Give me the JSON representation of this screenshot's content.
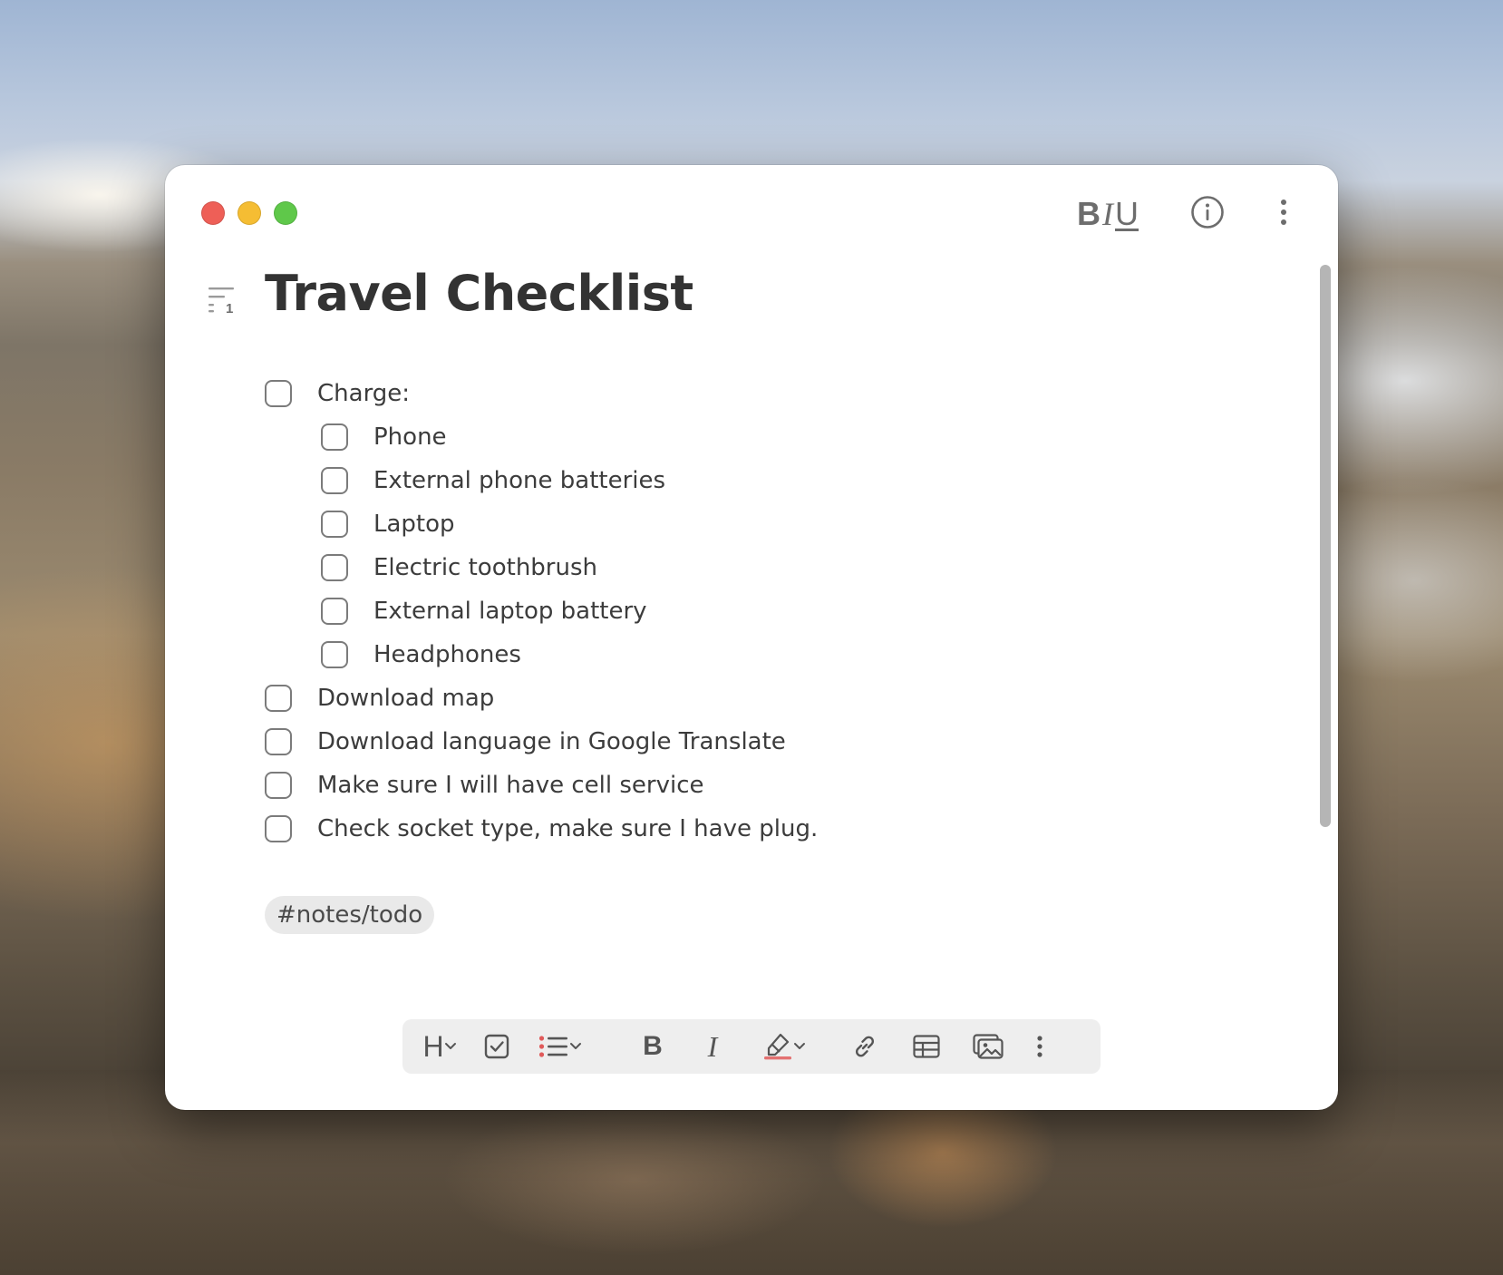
{
  "window": {
    "traffic_lights": [
      "close",
      "minimize",
      "zoom"
    ],
    "header": {
      "format_bold": "B",
      "format_italic": "I",
      "format_underline": "U",
      "info_icon": "info-circle-icon",
      "more_icon": "vertical-ellipsis-icon"
    }
  },
  "note": {
    "outline_number": "1",
    "title": "Travel Checklist",
    "todos": [
      {
        "label": "Charge:",
        "checked": false,
        "indent": 0
      },
      {
        "label": "Phone",
        "checked": false,
        "indent": 1
      },
      {
        "label": "External phone batteries",
        "checked": false,
        "indent": 1
      },
      {
        "label": "Laptop",
        "checked": false,
        "indent": 1
      },
      {
        "label": "Electric toothbrush",
        "checked": false,
        "indent": 1
      },
      {
        "label": "External laptop battery",
        "checked": false,
        "indent": 1
      },
      {
        "label": "Headphones",
        "checked": false,
        "indent": 1
      },
      {
        "label": "Download map",
        "checked": false,
        "indent": 0
      },
      {
        "label": "Download language in Google Translate",
        "checked": false,
        "indent": 0
      },
      {
        "label": "Make sure I will have cell service",
        "checked": false,
        "indent": 0
      },
      {
        "label": "Check socket type, make sure I have plug.",
        "checked": false,
        "indent": 0
      }
    ],
    "tag": "#notes/todo"
  },
  "toolbar": {
    "heading": "H",
    "bold": "B",
    "italic": "I",
    "icons": [
      "heading-dropdown-icon",
      "todo-checkbox-icon",
      "list-dropdown-icon",
      "bold-icon",
      "italic-icon",
      "highlighter-dropdown-icon",
      "link-icon",
      "table-icon",
      "image-icon",
      "more-icon"
    ],
    "highlight_color": "#e05a5a"
  },
  "colors": {
    "close": "#ee5f57",
    "minimize": "#f5bd33",
    "zoom": "#5fc84a",
    "list_bullet": "#e05a5a"
  }
}
